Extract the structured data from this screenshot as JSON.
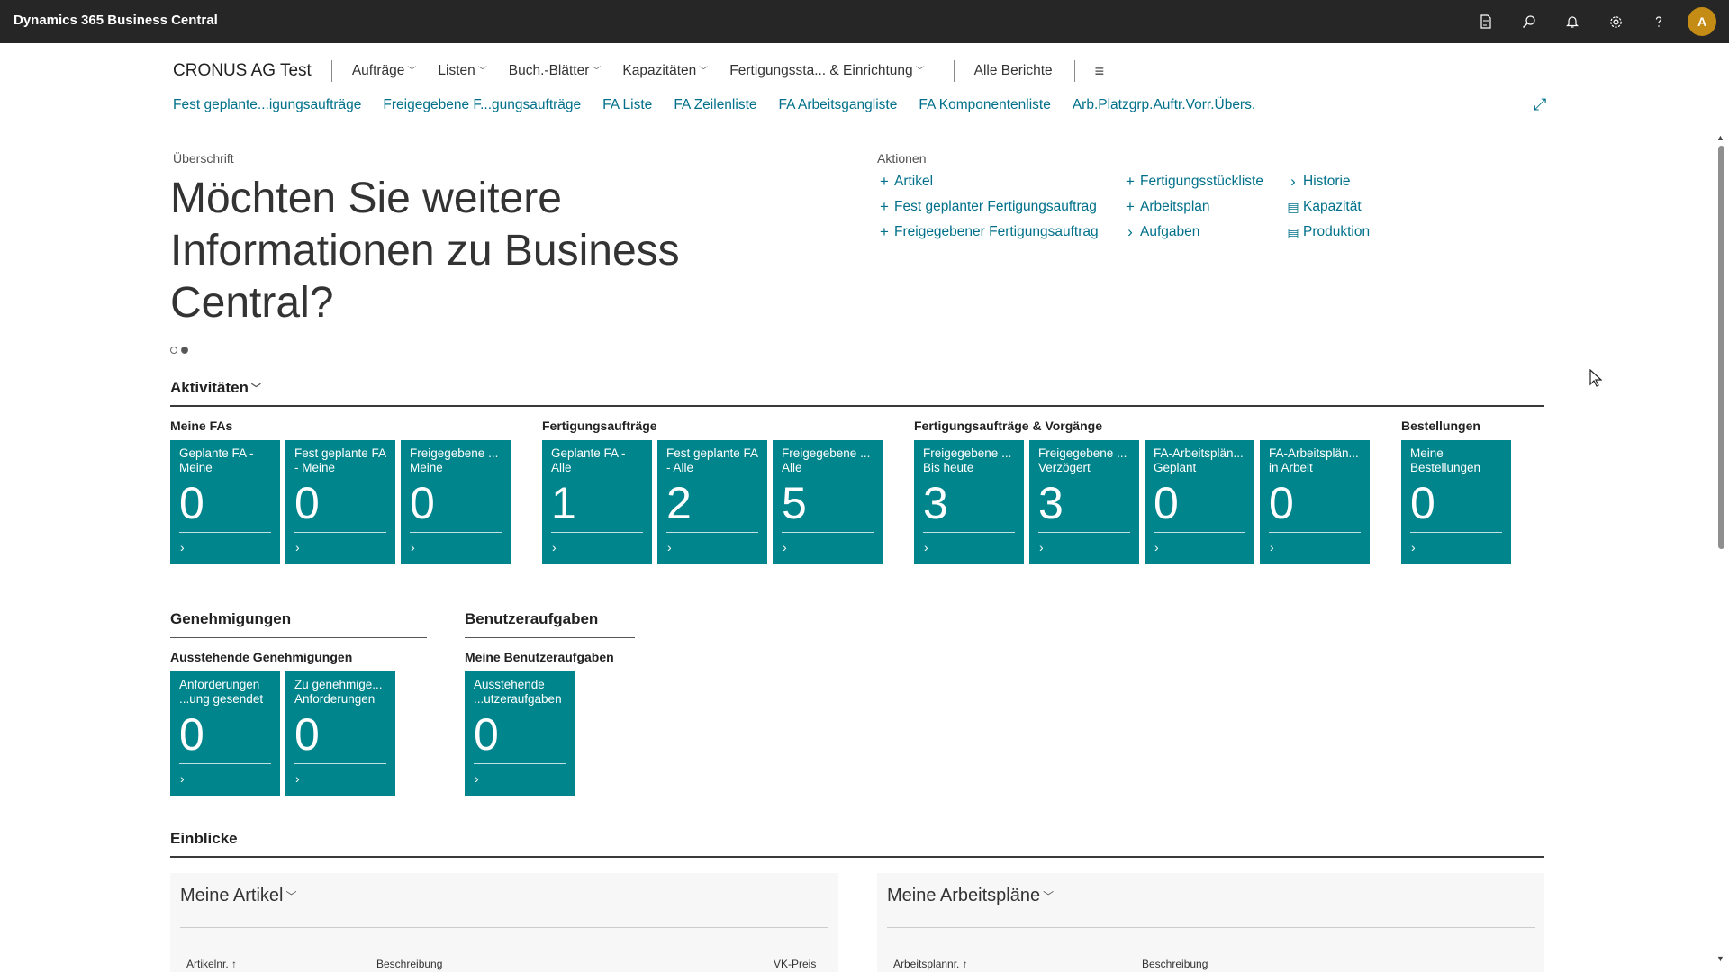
{
  "app": {
    "title": "Dynamics 365 Business Central"
  },
  "topbar_icons": [
    {
      "name": "document-icon",
      "glyph": "🗎"
    },
    {
      "name": "search-icon",
      "glyph": "⌕"
    },
    {
      "name": "bell-icon",
      "glyph": "🔔"
    },
    {
      "name": "gear-icon",
      "glyph": "⚙"
    },
    {
      "name": "help-icon",
      "glyph": "?"
    }
  ],
  "user": {
    "initial": "A",
    "color": "#c48c14"
  },
  "nav": {
    "company": "CRONUS AG Test",
    "items": [
      "Aufträge",
      "Listen",
      "Buch.-Blätter",
      "Kapazitäten",
      "Fertigungssta... & Einrichtung"
    ],
    "reports": "Alle Berichte",
    "menu_icon": "≡"
  },
  "sublinks": [
    "Fest geplante...igungsaufträge",
    "Freigegebene F...gungsaufträge",
    "FA Liste",
    "FA Zeilenliste",
    "FA Arbeitsgangliste",
    "FA Komponentenliste",
    "Arb.Platzgrp.Auftr.Vorr.Übers."
  ],
  "headline": {
    "label": "Überschrift",
    "text": "Möchten Sie weitere Informationen zu Business Central?"
  },
  "actions": {
    "label": "Aktionen",
    "col1": [
      {
        "icon": "plus-icon",
        "glyph": "+",
        "label": "Artikel"
      },
      {
        "icon": "plus-icon",
        "glyph": "+",
        "label": "Fest geplanter Fertigungsauftrag"
      },
      {
        "icon": "plus-icon",
        "glyph": "+",
        "label": "Freigegebener Fertigungsauftrag"
      }
    ],
    "col2": [
      {
        "icon": "plus-icon",
        "glyph": "+",
        "label": "Fertigungsstückliste"
      },
      {
        "icon": "plus-icon",
        "glyph": "+",
        "label": "Arbeitsplan"
      },
      {
        "icon": "chevron-right-icon",
        "glyph": "›",
        "label": "Aufgaben"
      }
    ],
    "col3": [
      {
        "icon": "chevron-right-icon",
        "glyph": "›",
        "label": "Historie"
      },
      {
        "icon": "report-icon",
        "glyph": "▤",
        "label": "Kapazität"
      },
      {
        "icon": "report-icon",
        "glyph": "▤",
        "label": "Produktion"
      }
    ]
  },
  "activities": {
    "title": "Aktivitäten",
    "groups": [
      {
        "label": "Meine FAs",
        "tiles": [
          {
            "label": "Geplante FA - Meine",
            "value": "0"
          },
          {
            "label": "Fest geplante FA - Meine",
            "value": "0"
          },
          {
            "label": "Freigegebene ... Meine",
            "value": "0"
          }
        ]
      },
      {
        "label": "Fertigungsaufträge",
        "tiles": [
          {
            "label": "Geplante FA - Alle",
            "value": "1"
          },
          {
            "label": "Fest geplante FA - Alle",
            "value": "2"
          },
          {
            "label": "Freigegebene ... Alle",
            "value": "5"
          }
        ]
      },
      {
        "label": "Fertigungsaufträge & Vorgänge",
        "tiles": [
          {
            "label": "Freigegebene ... Bis heute",
            "value": "3"
          },
          {
            "label": "Freigegebene ... Verzögert",
            "value": "3"
          },
          {
            "label": "FA-Arbeitsplän... Geplant",
            "value": "0"
          },
          {
            "label": "FA-Arbeitsplän... in Arbeit",
            "value": "0"
          }
        ]
      },
      {
        "label": "Bestellungen",
        "tiles": [
          {
            "label": "Meine Bestellungen",
            "value": "0"
          }
        ]
      }
    ]
  },
  "approvals": {
    "title": "Genehmigungen",
    "group_label": "Ausstehende Genehmigungen",
    "tiles": [
      {
        "label": "Anforderungen ...ung gesendet",
        "value": "0"
      },
      {
        "label": "Zu genehmige... Anforderungen",
        "value": "0"
      }
    ]
  },
  "user_tasks": {
    "title": "Benutzeraufgaben",
    "group_label": "Meine Benutzeraufgaben",
    "tiles": [
      {
        "label": "Ausstehende ...utzeraufgaben",
        "value": "0"
      }
    ]
  },
  "insights": {
    "title": "Einblicke",
    "cards": [
      {
        "title": "Meine Artikel",
        "columns": [
          "Artikelnr. ↑",
          "Beschreibung",
          "VK-Preis"
        ]
      },
      {
        "title": "Meine Arbeitspläne",
        "columns": [
          "Arbeitsplannr. ↑",
          "Beschreibung"
        ]
      }
    ]
  },
  "colors": {
    "topbar": "#262626",
    "tile": "#00858c",
    "link": "#00708a"
  }
}
